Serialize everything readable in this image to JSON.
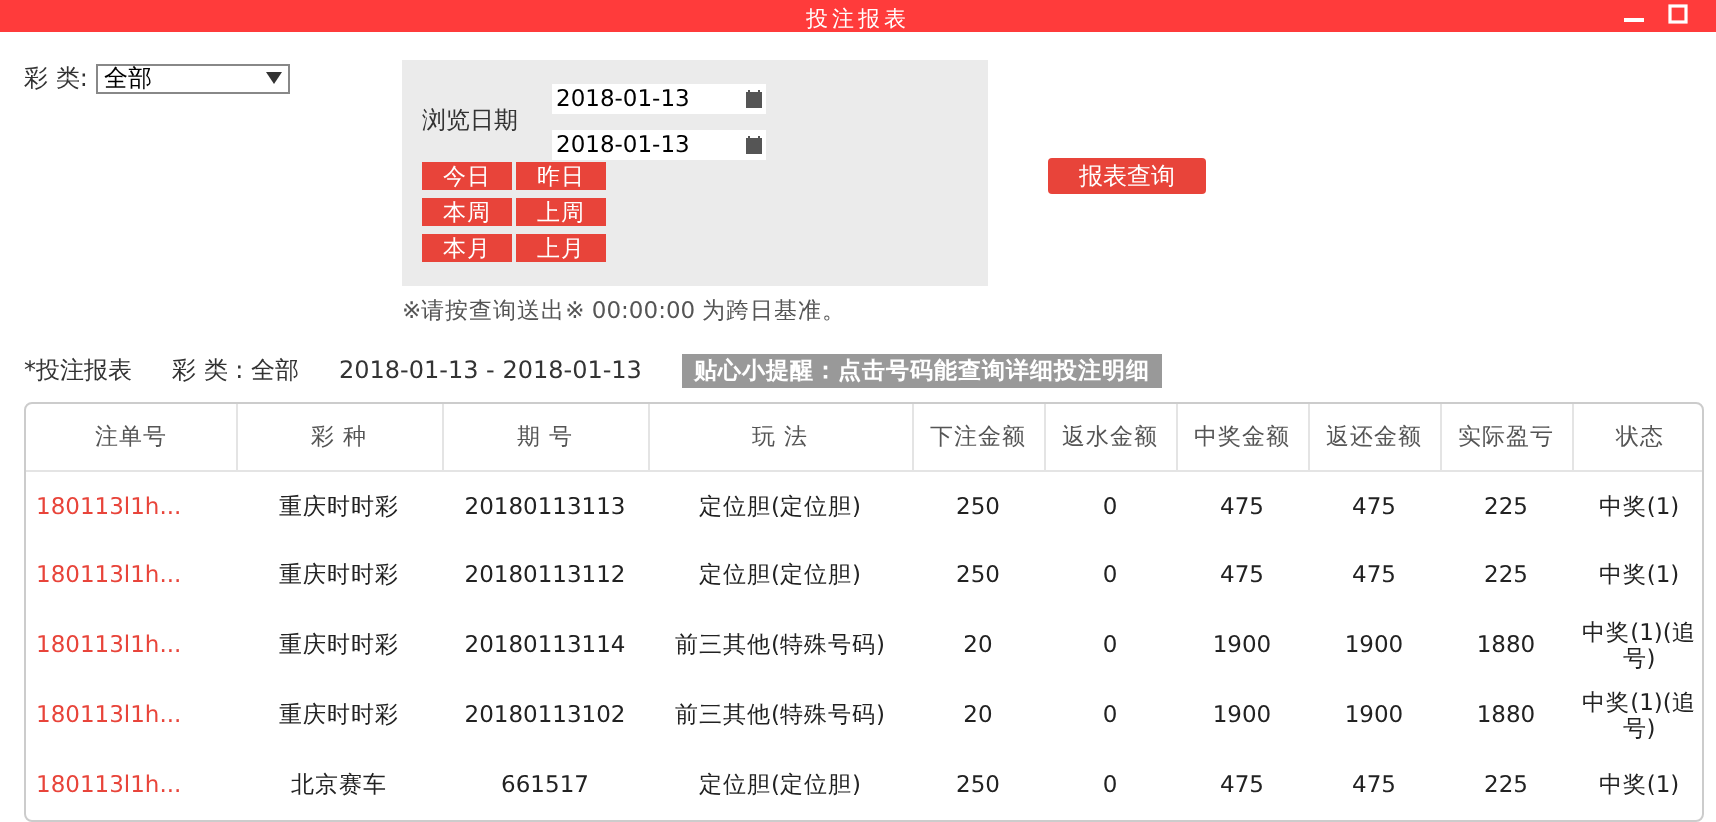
{
  "window": {
    "title": "投注报表"
  },
  "filter": {
    "lottery_label": "彩 类:",
    "lottery_value": "全部",
    "date_label": "浏览日期",
    "date_from": "2018-01-13",
    "date_to": "2018-01-13",
    "quick_buttons": [
      "今日",
      "昨日",
      "本周",
      "上周",
      "本月",
      "上月"
    ],
    "query_button": "报表查询",
    "note": "※请按查询送出※ 00:00:00 为跨日基准。"
  },
  "summary": {
    "title": "*投注报表",
    "lottery": "彩 类 : 全部",
    "range": "2018-01-13 - 2018-01-13",
    "tip": "贴心小提醒：点击号码能查询详细投注明细"
  },
  "table": {
    "columns": [
      "注单号",
      "彩 种",
      "期 号",
      "玩 法",
      "下注金额",
      "返水金额",
      "中奖金额",
      "返还金额",
      "实际盈亏",
      "状态"
    ],
    "rows": [
      [
        "180113l1h...",
        "重庆时时彩",
        "20180113113",
        "定位胆(定位胆)",
        "250",
        "0",
        "475",
        "475",
        "225",
        "中奖(1)"
      ],
      [
        "180113l1h...",
        "重庆时时彩",
        "20180113112",
        "定位胆(定位胆)",
        "250",
        "0",
        "475",
        "475",
        "225",
        "中奖(1)"
      ],
      [
        "180113l1h...",
        "重庆时时彩",
        "20180113114",
        "前三其他(特殊号码)",
        "20",
        "0",
        "1900",
        "1900",
        "1880",
        "中奖(1)(追号)"
      ],
      [
        "180113l1h...",
        "重庆时时彩",
        "20180113102",
        "前三其他(特殊号码)",
        "20",
        "0",
        "1900",
        "1900",
        "1880",
        "中奖(1)(追号)"
      ],
      [
        "180113l1h...",
        "北京赛车",
        "661517",
        "定位胆(定位胆)",
        "250",
        "0",
        "475",
        "475",
        "225",
        "中奖(1)"
      ]
    ]
  }
}
